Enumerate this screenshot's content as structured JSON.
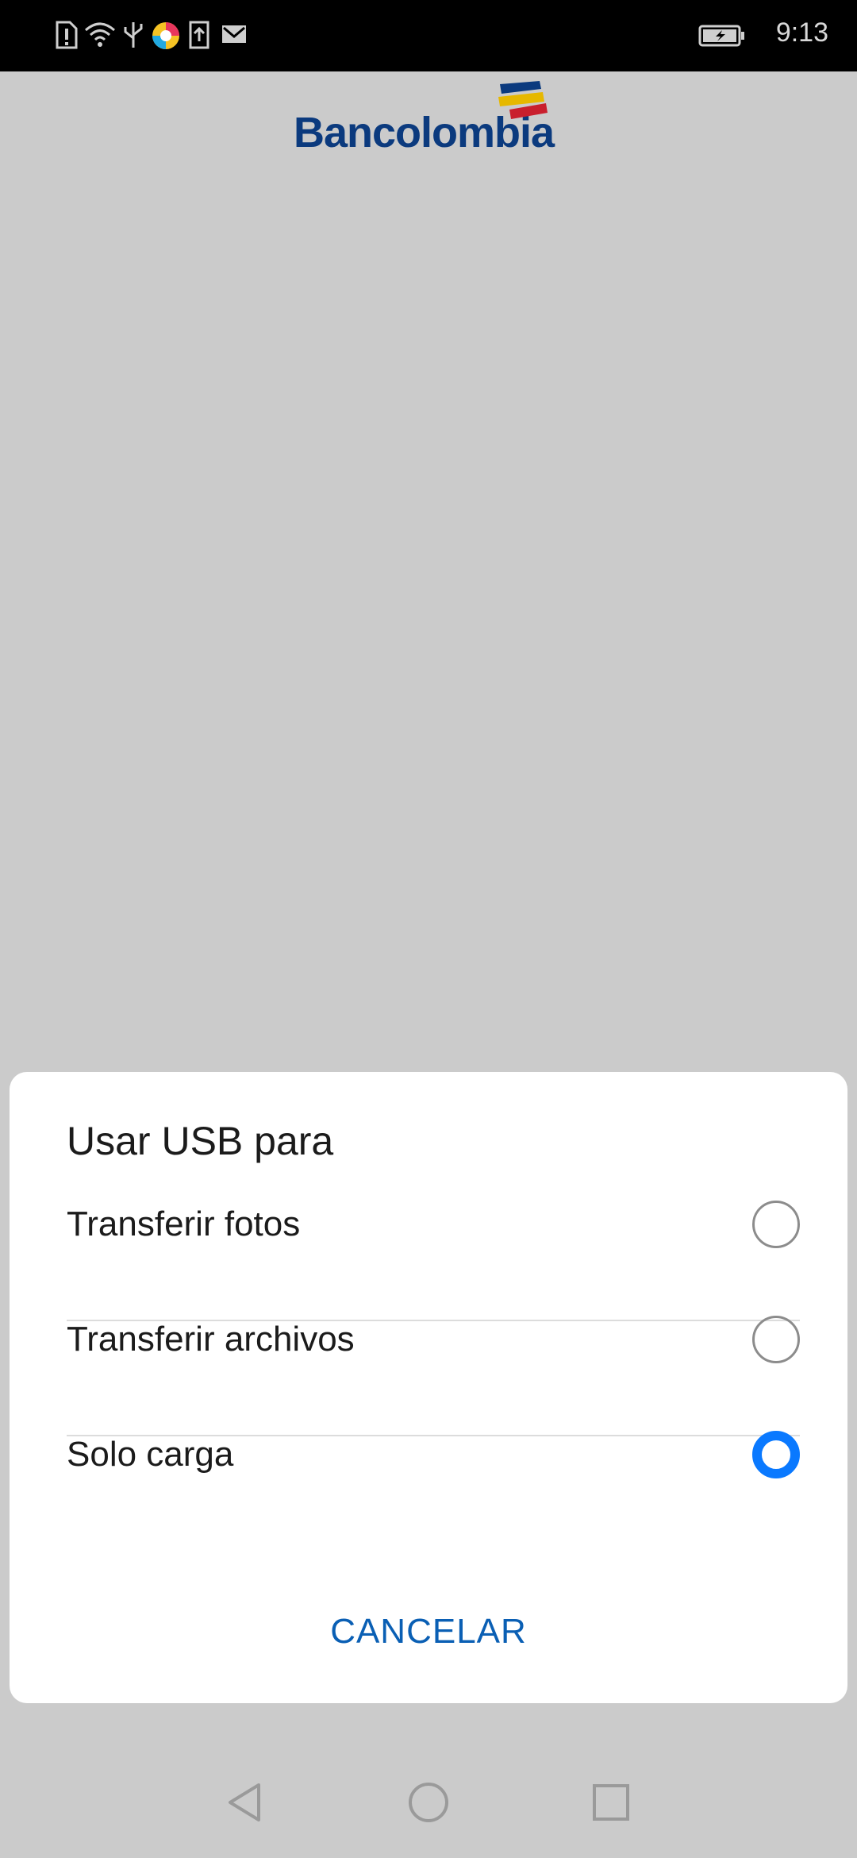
{
  "status_bar": {
    "time": "9:13",
    "icons": [
      "sim-alert-icon",
      "wifi-icon",
      "usb-icon",
      "app-icon",
      "upload-icon",
      "gmail-icon",
      "battery-charging-icon"
    ]
  },
  "background_app": {
    "brand_name": "Bancolombia",
    "brand_colors": [
      "#f2c300",
      "#0b3a7e",
      "#d3202f"
    ]
  },
  "dialog": {
    "title": "Usar USB para",
    "options": [
      {
        "label": "Transferir fotos",
        "selected": false
      },
      {
        "label": "Transferir archivos",
        "selected": false
      },
      {
        "label": "Solo carga",
        "selected": true
      }
    ],
    "cancel_label": "CANCELAR",
    "accent_color": "#0a79ff"
  },
  "nav_bar": {
    "buttons": [
      "back-icon",
      "home-icon",
      "recents-icon"
    ]
  }
}
